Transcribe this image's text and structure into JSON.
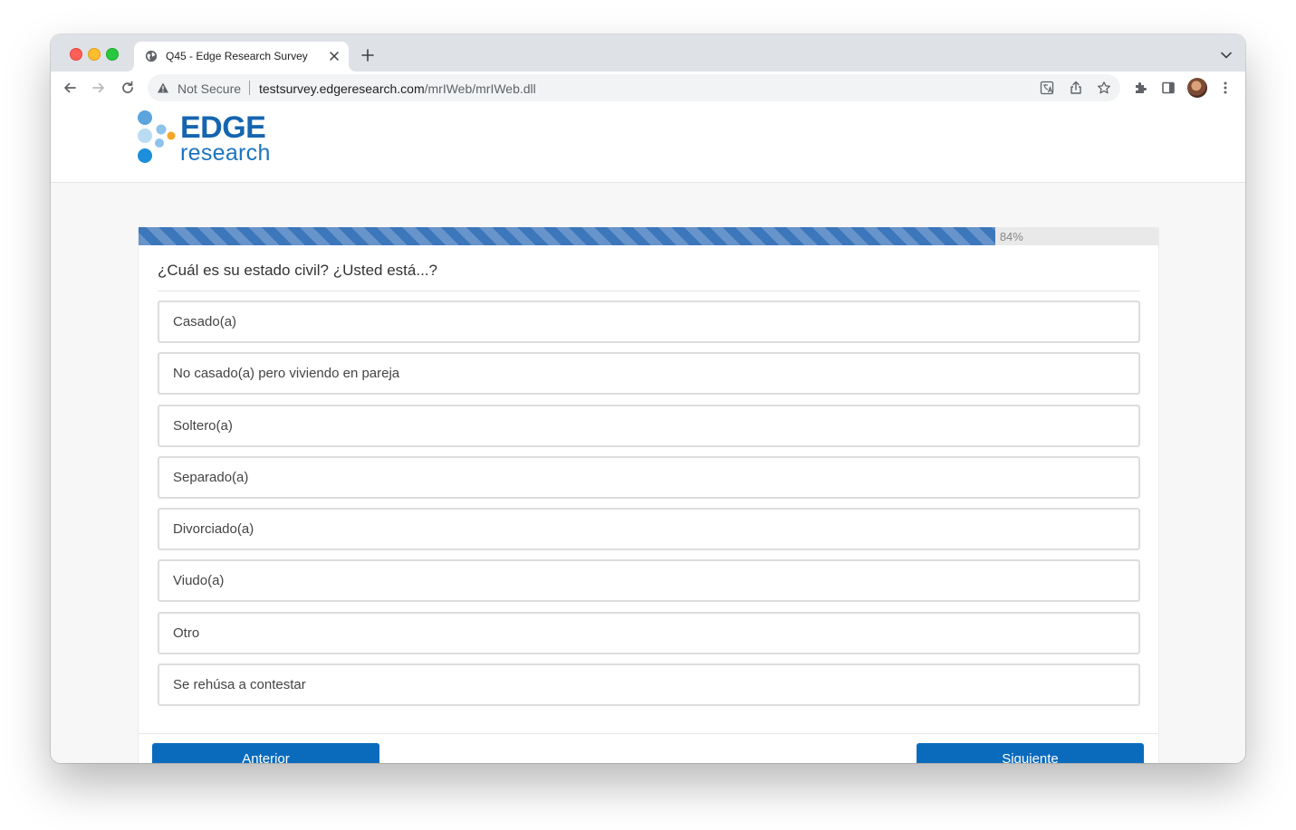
{
  "browser": {
    "tab_title": "Q45 - Edge Research Survey",
    "security_label": "Not Secure",
    "url_host": "testsurvey.edgeresearch.com",
    "url_path": "/mrIWeb/mrIWeb.dll"
  },
  "site": {
    "logo_top": "EDGE",
    "logo_bottom": "research",
    "brand_color": "#1565b0"
  },
  "survey": {
    "progress_label": "84%",
    "progress_value": 0.84,
    "question": "¿Cuál es su estado civil? ¿Usted está...?",
    "options": [
      "Casado(a)",
      "No casado(a) pero viviendo en pareja",
      "Soltero(a)",
      "Separado(a)",
      "Divorciado(a)",
      "Viudo(a)",
      "Otro",
      "Se rehúsa a contestar"
    ],
    "prev_label": "Anterior",
    "next_label": "Siguiente"
  }
}
